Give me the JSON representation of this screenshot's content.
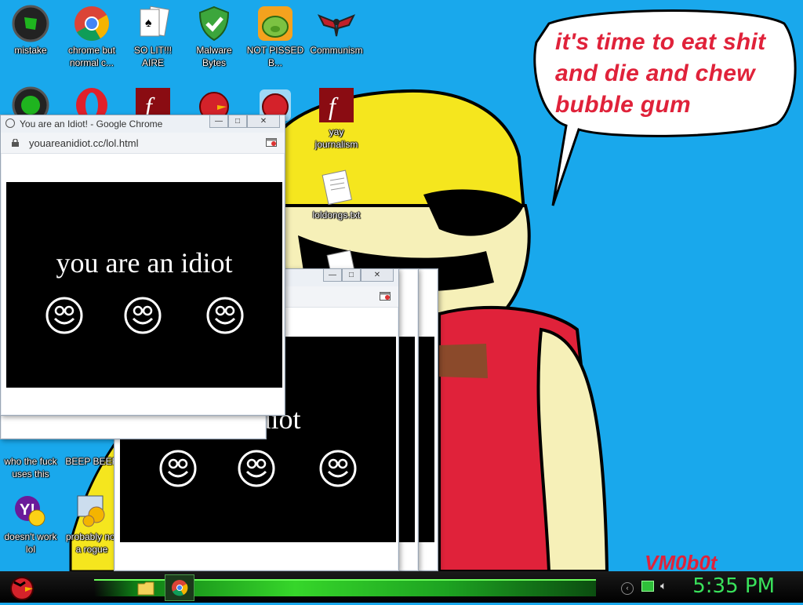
{
  "wallpaper": {
    "speech_bubble": "it's time to eat shit and die and chew bubble gum",
    "signature": "VM0b0t",
    "colors": {
      "sky": "#19a8ec",
      "helmet": "#f5e61e",
      "shirt": "#e0223a",
      "skin": "#f6f0b8"
    }
  },
  "desktop_icons": [
    {
      "label": "mistake",
      "icon": "razer-icon"
    },
    {
      "label": "chrome but normal c...",
      "icon": "chrome-icon"
    },
    {
      "label": "SO LIT!!! AIRE",
      "icon": "solitaire-cards-icon"
    },
    {
      "label": "Malware Bytes",
      "icon": "shield-check-icon"
    },
    {
      "label": "NOT PISSED B...",
      "icon": "angry-birds-pig-icon"
    },
    {
      "label": "Communism",
      "icon": "wing-emblem-icon"
    },
    {
      "label": "",
      "icon": "recycle-bin-icon"
    },
    {
      "label": "",
      "icon": "opera-icon"
    },
    {
      "label": "",
      "icon": "flash-icon"
    },
    {
      "label": "",
      "icon": "angry-bird-icon"
    },
    {
      "label": "",
      "icon": "angry-bird-icon"
    },
    {
      "label": "yay journalism",
      "icon": "flash-icon"
    },
    {
      "label": "loldongs.txt",
      "icon": "text-file-icon"
    },
    {
      "label": "who the fuck uses this",
      "icon": "internet-explorer-icon"
    },
    {
      "label": "BEEP BEEP",
      "icon": "app-icon"
    },
    {
      "label": "doesn't work lol",
      "icon": "yahoo-messenger-icon"
    },
    {
      "label": "probably not a rogue",
      "icon": "system-gears-icon"
    }
  ],
  "main_window": {
    "title": "You are an Idiot! - Google Chrome",
    "url": "youareanidiot.cc/lol.html",
    "message": "you are an idiot"
  },
  "back_window": {
    "message": "an idiot"
  },
  "taskbar": {
    "clock": "5:35 PM"
  }
}
